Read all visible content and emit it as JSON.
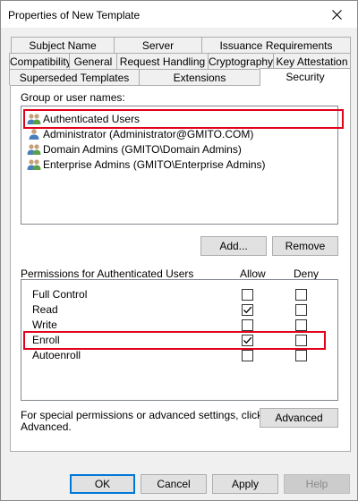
{
  "window": {
    "title": "Properties of New Template"
  },
  "tabs": {
    "row1": [
      "Subject Name",
      "Server",
      "Issuance Requirements"
    ],
    "row2": [
      "Compatibility",
      "General",
      "Request Handling",
      "Cryptography",
      "Key Attestation"
    ],
    "row3": [
      "Superseded Templates",
      "Extensions",
      "Security"
    ],
    "active": "Security"
  },
  "security": {
    "group_label": "Group or user names:",
    "users": [
      "Authenticated Users",
      "Administrator (Administrator@GMITO.COM)",
      "Domain Admins (GMITO\\Domain Admins)",
      "Enterprise Admins (GMITO\\Enterprise Admins)"
    ],
    "selected_user": "Authenticated Users",
    "add_button": "Add...",
    "remove_button": "Remove",
    "permissions_label": "Permissions for Authenticated Users",
    "allow_header": "Allow",
    "deny_header": "Deny",
    "permissions": [
      {
        "name": "Full Control",
        "allow": false,
        "deny": false
      },
      {
        "name": "Read",
        "allow": true,
        "deny": false
      },
      {
        "name": "Write",
        "allow": false,
        "deny": false
      },
      {
        "name": "Enroll",
        "allow": true,
        "deny": false
      },
      {
        "name": "Autoenroll",
        "allow": false,
        "deny": false
      }
    ],
    "special_text_1": "For special permissions or advanced settings, click",
    "special_text_2": "Advanced.",
    "advanced_button": "Advanced"
  },
  "footer": {
    "ok": "OK",
    "cancel": "Cancel",
    "apply": "Apply",
    "help": "Help"
  },
  "colors": {
    "highlight": "#e3001b",
    "accent": "#0078d7",
    "check": "#000000"
  },
  "icons": {
    "close": "close-icon",
    "user": "user-group-icon",
    "checkmark": "checkmark-icon"
  }
}
